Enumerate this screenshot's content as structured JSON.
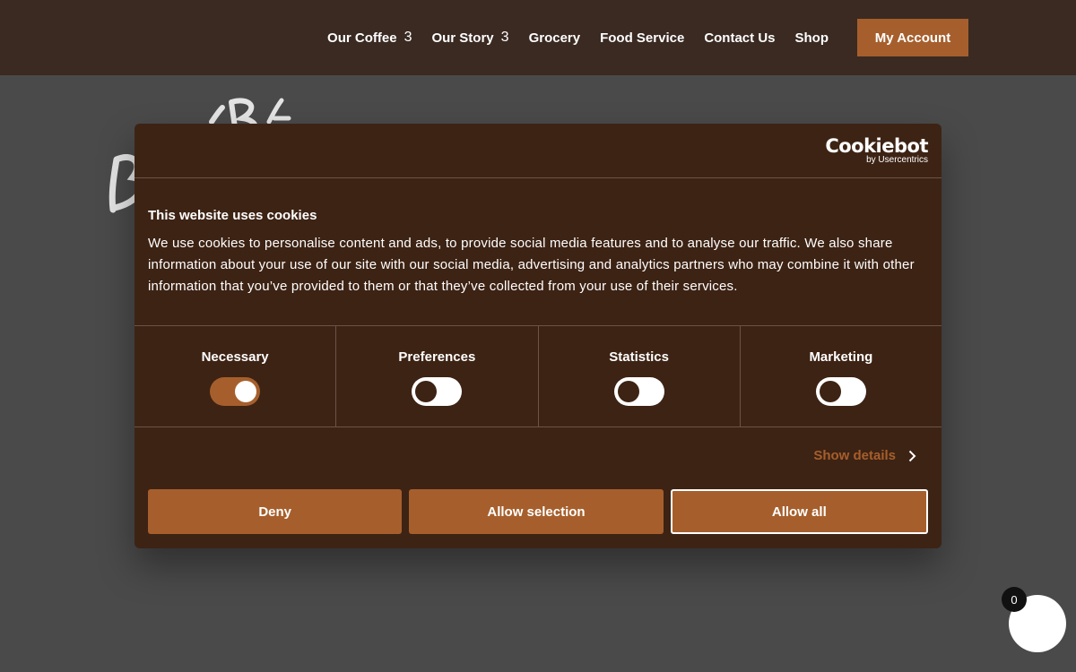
{
  "header": {
    "nav": [
      {
        "label": "Our Coffee",
        "caret": "3"
      },
      {
        "label": "Our Story",
        "caret": "3"
      },
      {
        "label": "Grocery"
      },
      {
        "label": "Food Service"
      },
      {
        "label": "Contact Us"
      },
      {
        "label": "Shop"
      }
    ],
    "account_label": "My Account"
  },
  "dialog": {
    "brand_name": "Cookiebot",
    "brand_sub": "by Usercentrics",
    "title": "This website uses cookies",
    "text": "We use cookies to personalise content and ads, to provide social media features and to analyse our traffic. We also share information about your use of our site with our social media, advertising and analytics partners who may combine it with other information that you’ve provided to them or that they’ve collected from your use of their services.",
    "toggles": [
      {
        "label": "Necessary",
        "on": true
      },
      {
        "label": "Preferences",
        "on": false
      },
      {
        "label": "Statistics",
        "on": false
      },
      {
        "label": "Marketing",
        "on": false
      }
    ],
    "details_label": "Show details",
    "buttons": {
      "deny": "Deny",
      "allow_selection": "Allow selection",
      "allow_all": "Allow all"
    }
  },
  "cart": {
    "count": "0"
  },
  "colors": {
    "header_bg": "#3a2a22",
    "accent": "#a65f2c",
    "dialog_bg": "#3d2314",
    "overlay": "#4a4a4a"
  }
}
